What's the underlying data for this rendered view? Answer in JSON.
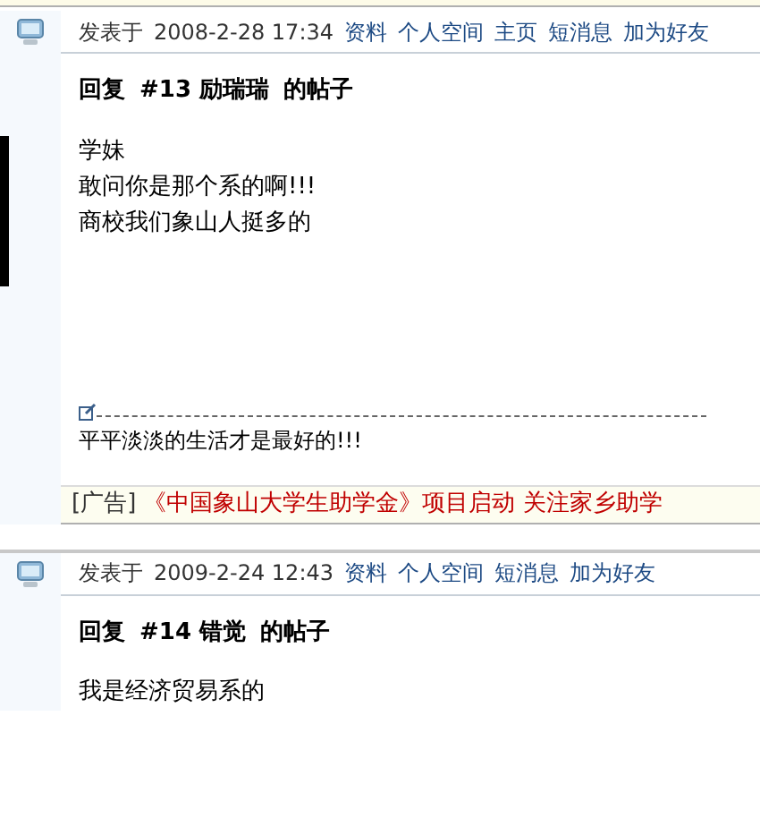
{
  "posts": [
    {
      "posted_label": "发表于",
      "time": "2008-2-28 17:34",
      "links": [
        "资料",
        "个人空间",
        "主页",
        "短消息",
        "加为好友"
      ],
      "title_prefix": "回复",
      "title_ref": "#13 励瑞瑞",
      "title_suffix": "的帖子",
      "body": [
        "学妹",
        "敢问你是那个系的啊!!!",
        "商校我们象山人挺多的"
      ],
      "signature": "平平淡淡的生活才是最好的!!!",
      "ad": {
        "tag": "[广告]",
        "text": "《中国象山大学生助学金》项目启动 关注家乡助学"
      }
    },
    {
      "posted_label": "发表于",
      "time": "2009-2-24 12:43",
      "links": [
        "资料",
        "个人空间",
        "短消息",
        "加为好友"
      ],
      "title_prefix": "回复",
      "title_ref": "#14 错觉",
      "title_suffix": "的帖子",
      "body": [
        "我是经济贸易系的"
      ]
    }
  ]
}
